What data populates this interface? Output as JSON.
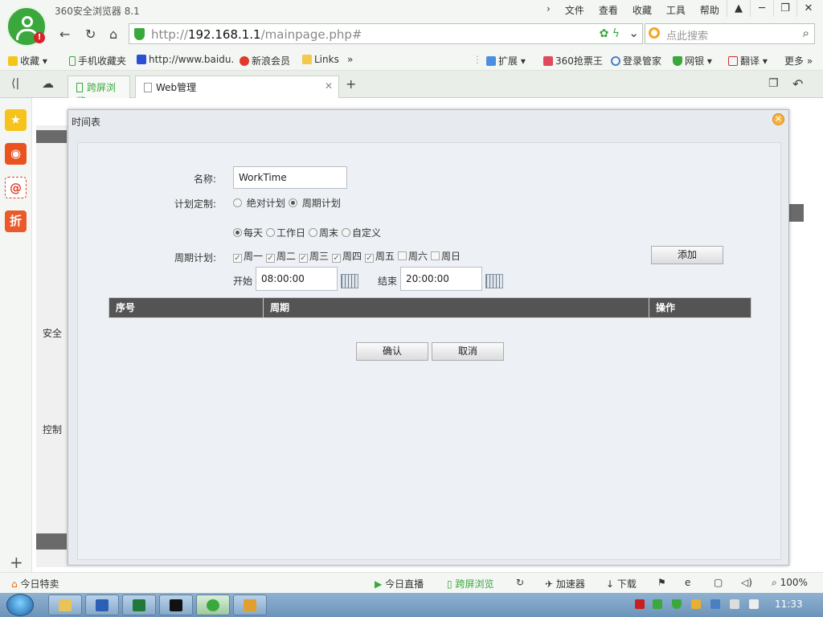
{
  "browser": {
    "app_title": "360安全浏览器 8.1",
    "menu": [
      "文件",
      "查看",
      "收藏",
      "工具",
      "帮助"
    ],
    "url_prefix": "http://",
    "url_host": "192.168.1.1",
    "url_path": "/mainpage.php#",
    "search_placeholder": "点此搜索",
    "bookmarks": {
      "fav": "收藏",
      "mobile": "手机收藏夹",
      "baidu": "http://www.baidu.",
      "sina": "新浪会员",
      "links": "Links",
      "extend": "扩展",
      "ticket": "360抢票王",
      "login": "登录管家",
      "bank": "网银",
      "translate": "翻译",
      "more": "更多"
    },
    "tabs": {
      "split": "跨屏浏览",
      "web": "Web管理"
    },
    "status": {
      "today_deal": "今日特卖",
      "live": "今日直播",
      "split": "跨屏浏览",
      "accel": "加速器",
      "download": "下载",
      "zoom": "100%"
    },
    "clock": "11:33"
  },
  "background_page": {
    "security_label": "安全",
    "control_label": "控制"
  },
  "dialog": {
    "title": "时间表",
    "name_label": "名称:",
    "name_value": "WorkTime",
    "plan_label": "计划定制:",
    "plan_absolute": "绝对计划",
    "plan_periodic": "周期计划",
    "period_label": "周期计划:",
    "period_daily": "每天",
    "period_workday": "工作日",
    "period_weekend": "周末",
    "period_custom": "自定义",
    "days": [
      "周一",
      "周二",
      "周三",
      "周四",
      "周五",
      "周六",
      "周日"
    ],
    "start_label": "开始",
    "start_value": "08:00:00",
    "end_label": "结束",
    "end_value": "20:00:00",
    "add_button": "添加",
    "table_headers": [
      "序号",
      "周期",
      "操作"
    ],
    "confirm_button": "确认",
    "cancel_button": "取消"
  },
  "colors": {
    "brand_green": "#3aa83c",
    "table_header_bg": "#545454"
  }
}
